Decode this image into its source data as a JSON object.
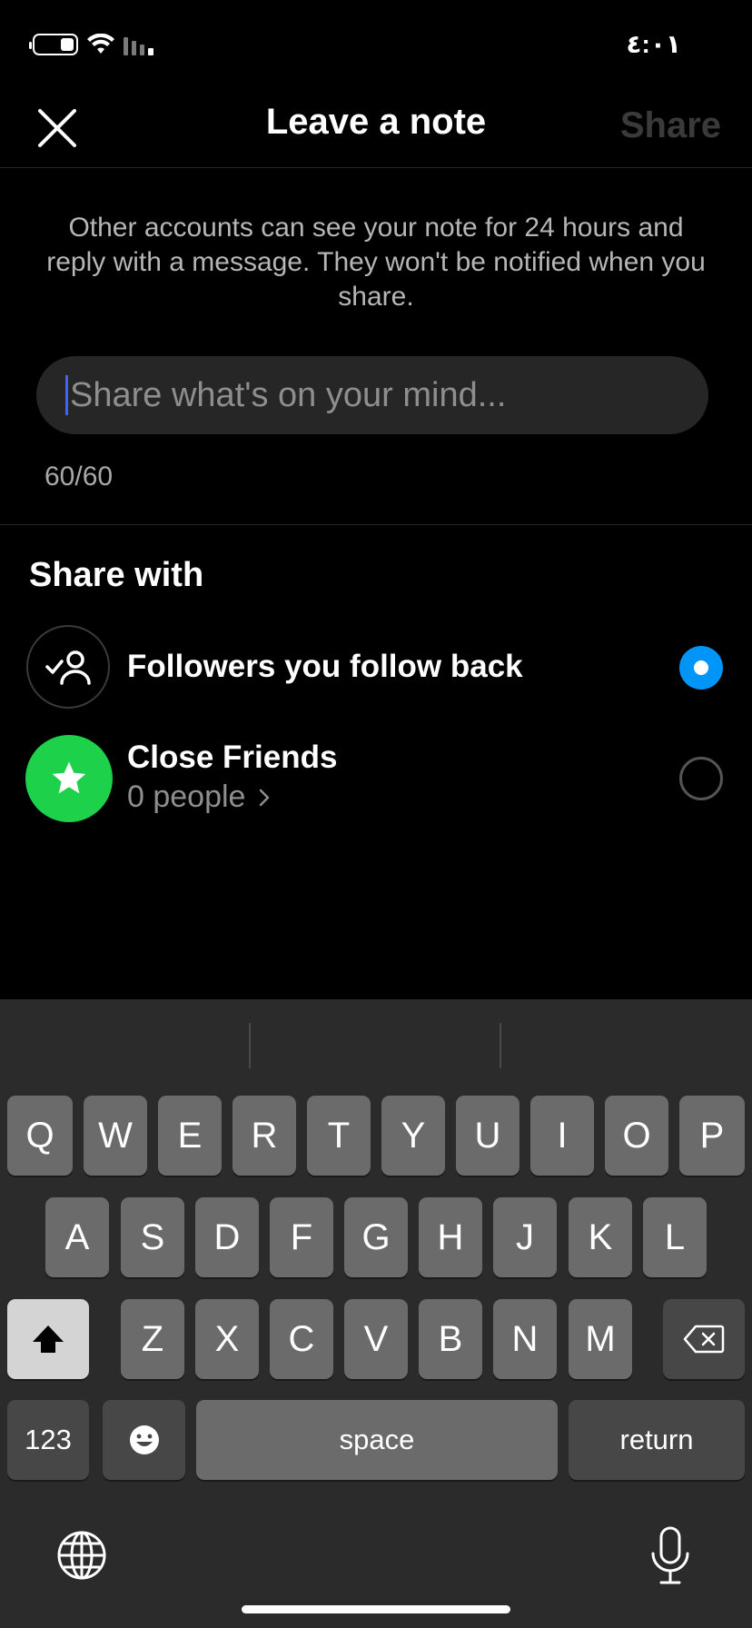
{
  "status_bar": {
    "time": "٤:٠١"
  },
  "header": {
    "title": "Leave a note",
    "share_label": "Share"
  },
  "info_text": "Other accounts can see your note for 24 hours and reply with a message. They won't be notified when you share.",
  "note_input": {
    "placeholder": "Share what's on your mind...",
    "counter": "60/60"
  },
  "share_with": {
    "title": "Share with",
    "options": [
      {
        "label": "Followers you follow back",
        "selected": true
      },
      {
        "label": "Close Friends",
        "subtitle": "0 people",
        "selected": false
      }
    ]
  },
  "keyboard": {
    "row1": [
      "Q",
      "W",
      "E",
      "R",
      "T",
      "Y",
      "U",
      "I",
      "O",
      "P"
    ],
    "row2": [
      "A",
      "S",
      "D",
      "F",
      "G",
      "H",
      "J",
      "K",
      "L"
    ],
    "row3": [
      "Z",
      "X",
      "C",
      "V",
      "B",
      "N",
      "M"
    ],
    "numbers_label": "123",
    "space_label": "space",
    "return_label": "return"
  },
  "colors": {
    "accent": "#0095f6",
    "close_friends": "#1dd14a",
    "caret": "#3e63ff"
  }
}
